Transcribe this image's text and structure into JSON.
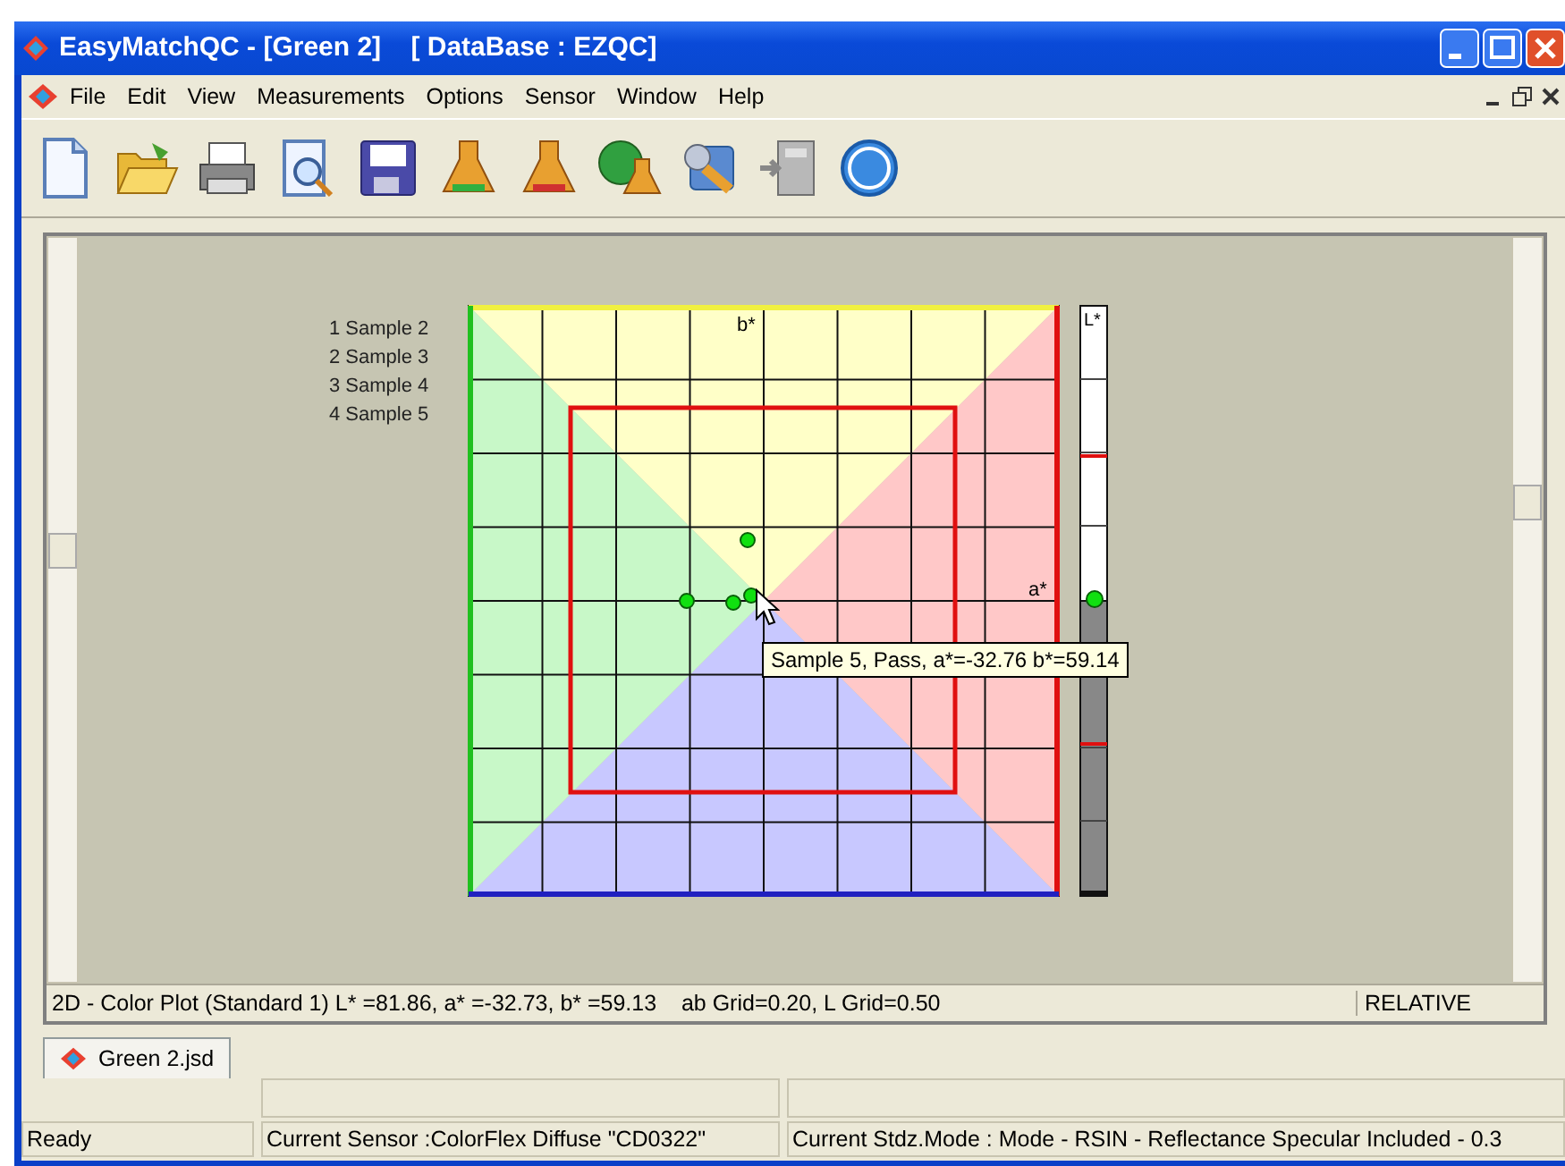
{
  "window": {
    "title": "EasyMatchQC - [Green 2]    [ DataBase : EZQC]"
  },
  "menu": [
    "File",
    "Edit",
    "View",
    "Measurements",
    "Options",
    "Sensor",
    "Window",
    "Help"
  ],
  "plot": {
    "legend": [
      "1 Sample 2",
      "2 Sample 3",
      "3 Sample 4",
      "4 Sample 5"
    ],
    "axis_labels": {
      "b": "b*",
      "a": "a*",
      "l": "L*"
    },
    "tooltip": "Sample 5, Pass, a*=-32.76 b*=59.14",
    "status": "2D - Color Plot (Standard 1) L* =81.86, a* =-32.73, b* =59.13    ab Grid=0.20, L Grid=0.50",
    "mode": "RELATIVE"
  },
  "document_tabs": [
    {
      "label": "Green 2.jsd",
      "selected": true
    }
  ],
  "status_bar": [
    "Ready",
    "Current Sensor :ColorFlex Diffuse \"CD0322\"",
    "Current Stdz.Mode :  Mode - RSIN - Reflectance Specular Included - 0.3"
  ]
}
